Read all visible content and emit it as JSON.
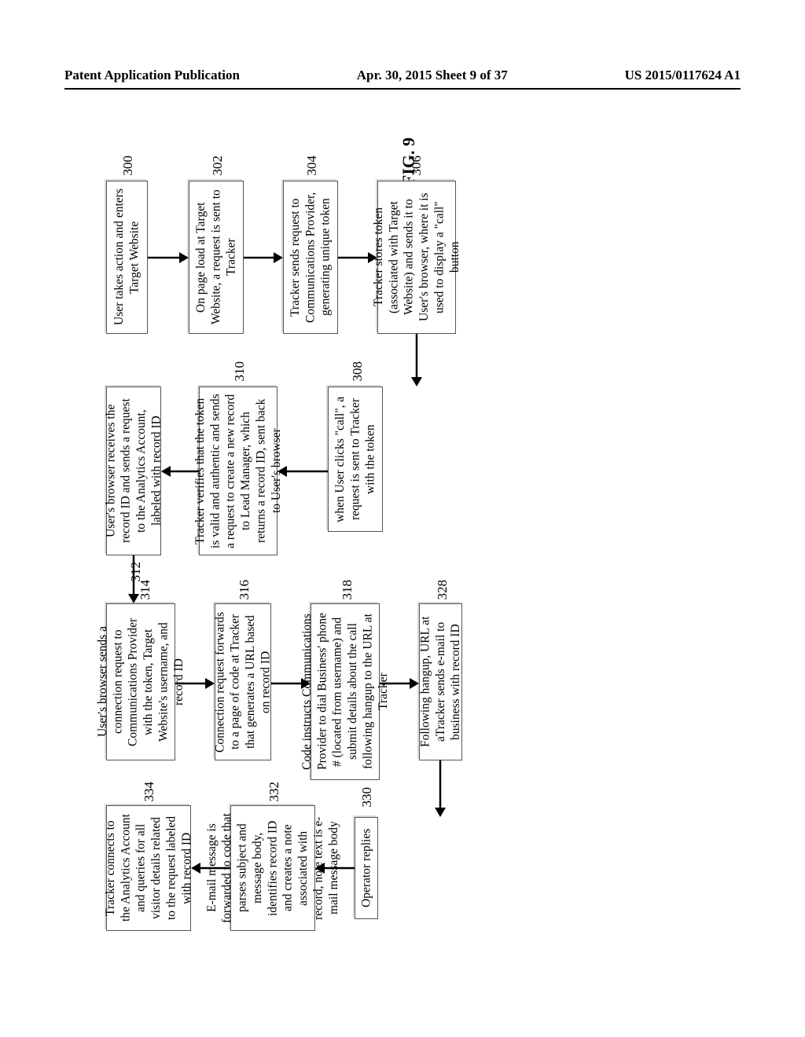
{
  "header": {
    "left": "Patent Application Publication",
    "center": "Apr. 30, 2015  Sheet 9 of 37",
    "right": "US 2015/0117624 A1"
  },
  "figure_title": "FIG. 9",
  "refs": {
    "r300": "300",
    "r302": "302",
    "r304": "304",
    "r306": "306",
    "r308": "308",
    "r310": "310",
    "r312": "312",
    "r314": "314",
    "r316": "316",
    "r318": "318",
    "r328": "328",
    "r330": "330",
    "r332": "332",
    "r334": "334"
  },
  "boxes": {
    "b300": "User takes action  and enters Target Website",
    "b302": "On page load at Target Website, a request is sent to Tracker",
    "b304": "Tracker sends request to Communications Provider, generating unique token",
    "b306": "Tracker stores token (associated with Target Website) and sends it to User's browser, where it is used to display a \"call\" button",
    "b308": "when User clicks \"call\", a request is sent to Tracker with the token",
    "b310": "Tracker verifies that the token is valid and authentic and sends a request to create a new record to Lead Manager, which returns a record ID, sent back to User's browser",
    "b312": "User's browser receives the record ID and sends a request to the Analytics Account, labeled with record ID",
    "b314": "User's browser sends a connection request to Communications Provider with the token, Target Website's username, and record ID",
    "b316": "Connection request forwards to a page of code at Tracker that generates a URL based on record ID",
    "b318": "Code instructs Communications Provider to dial Business' phone # (located from username) and submit details about the call following hangup to the URL at Tracker",
    "b328": "Following hangup, URL at aTracker sends e-mail to business with record ID",
    "b330": "Operator replies",
    "b332": "E-mail message is forwarded to code that parses subject and message body, identifies record ID and creates a note associated with record, note text is e-mail message body",
    "b334": "Tracker connects to the Analytics Account and queries for all visitor details related to the request labeled with record ID"
  }
}
